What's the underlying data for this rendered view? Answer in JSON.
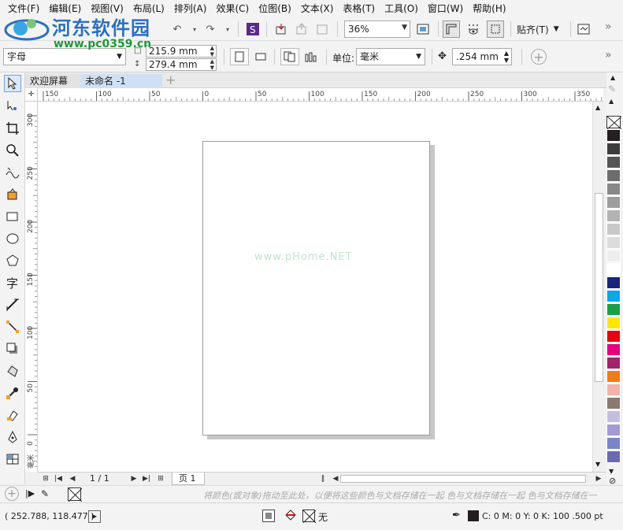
{
  "menu": [
    "文件(F)",
    "编辑(E)",
    "视图(V)",
    "布局(L)",
    "排列(A)",
    "效果(C)",
    "位图(B)",
    "文本(X)",
    "表格(T)",
    "工具(O)",
    "窗口(W)",
    "帮助(H)"
  ],
  "watermark": {
    "title": "河东软件园",
    "url": "www.pc0359.cn",
    "canvas_text": "www.pHome.NET"
  },
  "toolbar": {
    "zoom": "36%",
    "snap_label": "贴齐(T)"
  },
  "property_bar": {
    "preset": "字母",
    "width": "215.9 mm",
    "height": "279.4 mm",
    "units_label": "单位:",
    "units": "毫米",
    "nudge": ".254 mm"
  },
  "tabs": [
    "欢迎屏幕",
    "未命名 -1"
  ],
  "ruler": {
    "h_labels": [
      "150",
      "100",
      "50",
      "0",
      "50",
      "100",
      "150",
      "200",
      "250",
      "300",
      "350"
    ],
    "v_labels": [
      "300",
      "250",
      "200",
      "150",
      "100",
      "50",
      "0"
    ],
    "unit": "毫米"
  },
  "page_nav": {
    "counter": "1 / 1",
    "page_tab": "页 1"
  },
  "doc_palette_hint": "将颜色(或对象)拖动至此处，以便将这些颜色与文档存储在一起 色与文档存储在一起 色与文档存储在一",
  "status": {
    "cursor": "( 252.788, 118.477 )",
    "fill": "无",
    "outline": "C: 0 M: 0 Y: 0 K: 100   .500 pt"
  },
  "palette_colors": [
    "#231f20",
    "#3d3d3d",
    "#555555",
    "#6d6d6d",
    "#888888",
    "#9d9d9d",
    "#b3b3b3",
    "#c8c8c8",
    "#dcdcdc",
    "#eeeeee",
    "#ffffff",
    "#1a237e",
    "#0ea5e9",
    "#1b9e4b",
    "#ffe600",
    "#e60012",
    "#e4007f",
    "#a0246a",
    "#ee7c1a",
    "#f2b3a9",
    "#8b7a70",
    "#c6bee0",
    "#a29ad0",
    "#7a85c5",
    "#6a6ab0"
  ]
}
